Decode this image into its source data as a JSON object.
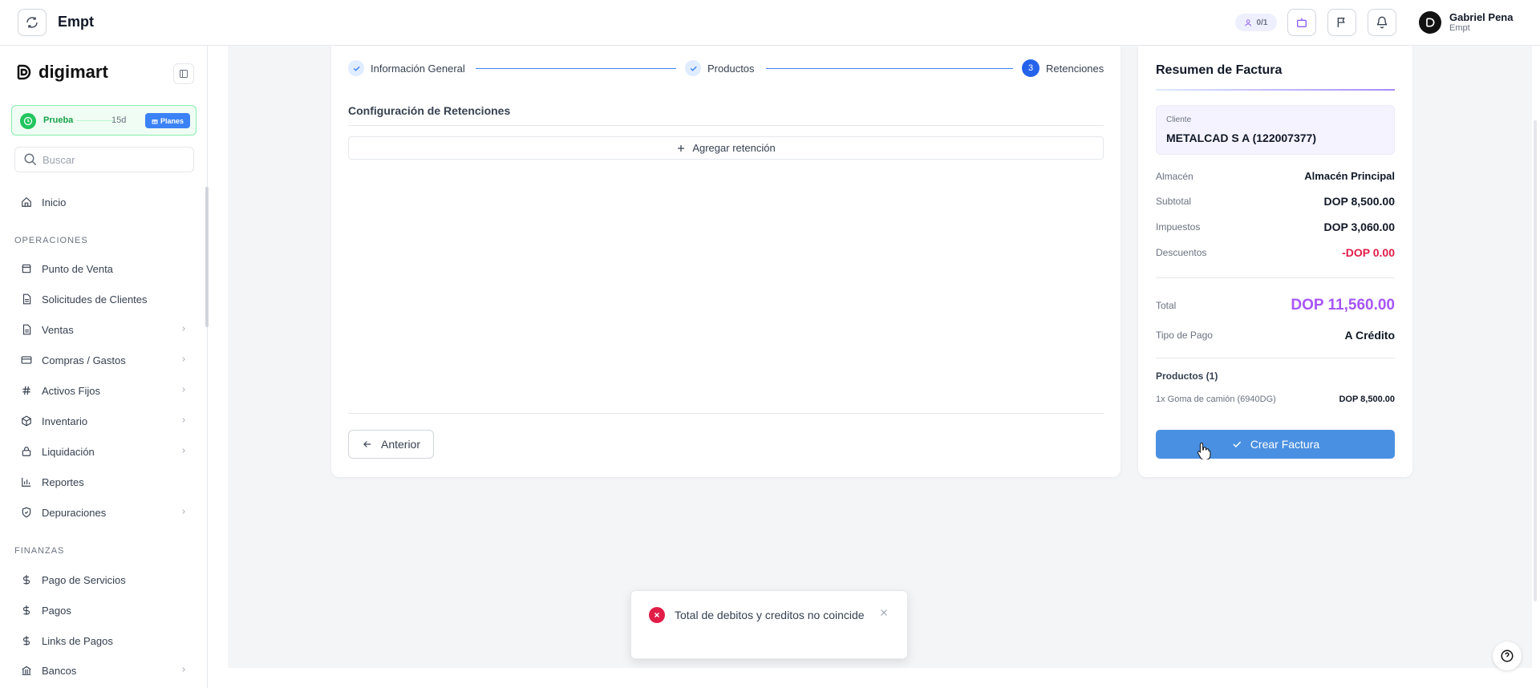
{
  "topbar": {
    "title": "Empt",
    "usage": "0/1",
    "user_name": "Gabriel Pena",
    "user_org": "Empt"
  },
  "sidebar": {
    "brand": "digimart",
    "trial": {
      "label": "Prueba",
      "days": "15d",
      "plans": "Planes"
    },
    "search_placeholder": "Buscar",
    "home": "Inicio",
    "sections": [
      {
        "label": "OPERACIONES",
        "items": [
          {
            "label": "Punto de Venta",
            "icon": "store-icon"
          },
          {
            "label": "Solicitudes de Clientes",
            "icon": "document-icon"
          },
          {
            "label": "Ventas",
            "icon": "document-icon"
          },
          {
            "label": "Compras / Gastos",
            "icon": "card-icon"
          },
          {
            "label": "Activos Fijos",
            "icon": "hash-icon"
          },
          {
            "label": "Inventario",
            "icon": "box-icon"
          },
          {
            "label": "Liquidación",
            "icon": "lock-icon"
          },
          {
            "label": "Reportes",
            "icon": "bar-chart-icon"
          },
          {
            "label": "Depuraciones",
            "icon": "shield-icon"
          }
        ]
      },
      {
        "label": "FINANZAS",
        "items": [
          {
            "label": "Pago de Servicios",
            "icon": "dollar-icon"
          },
          {
            "label": "Pagos",
            "icon": "dollar-icon"
          },
          {
            "label": "Links de Pagos",
            "icon": "dollar-icon"
          },
          {
            "label": "Bancos",
            "icon": "bank-icon"
          }
        ]
      }
    ]
  },
  "steps": [
    {
      "label": "Información General",
      "state": "done"
    },
    {
      "label": "Productos",
      "state": "done"
    },
    {
      "number": "3",
      "label": "Retenciones",
      "state": "current"
    }
  ],
  "main": {
    "section_title": "Configuración de Retenciones",
    "add_retention": "Agregar retención",
    "prev_button": "Anterior"
  },
  "summary": {
    "title": "Resumen de Factura",
    "client_label": "Cliente",
    "client_name": "METALCAD S A (122007377)",
    "rows": {
      "warehouse": {
        "label": "Almacén",
        "value": "Almacén Principal"
      },
      "subtotal": {
        "label": "Subtotal",
        "value": "DOP 8,500.00"
      },
      "taxes": {
        "label": "Impuestos",
        "value": "DOP 3,060.00"
      },
      "discounts": {
        "label": "Descuentos",
        "value": "-DOP 0.00"
      },
      "total": {
        "label": "Total",
        "value": "DOP 11,560.00"
      },
      "payment_type": {
        "label": "Tipo de Pago",
        "value": "A Crédito"
      }
    },
    "products_label": "Productos (1)",
    "product_item": {
      "name": "1x Goma de camión (6940DG)",
      "price": "DOP 8,500.00"
    },
    "create_button": "Crear Factura"
  },
  "toast": {
    "message": "Total de debitos y creditos no coincide"
  },
  "colors": {
    "primary": "#2563eb",
    "total": "#a855f7",
    "discount": "#e11d48",
    "trial": "#22c55e",
    "create_button": "#4a90e2"
  }
}
